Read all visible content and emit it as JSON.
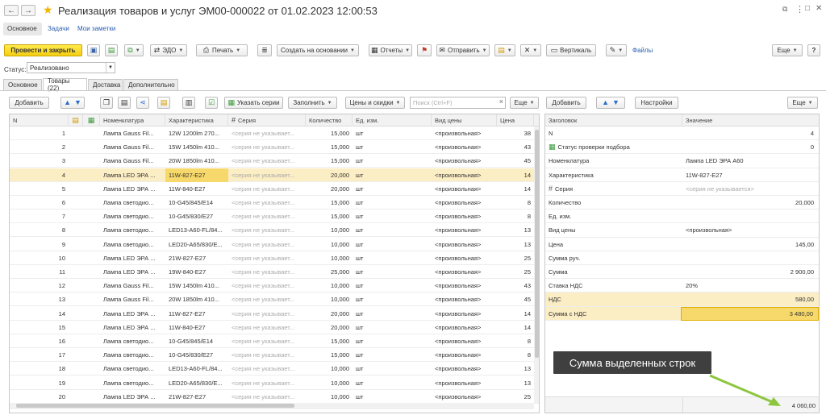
{
  "window": {
    "title": "Реализация товаров и услуг ЭМ00-000022 от 01.02.2023 12:00:53",
    "nav_back": "←",
    "nav_forward": "→",
    "star": "★",
    "link_icon": "🔗",
    "more_icon": "⋮",
    "maximize_icon": "□",
    "close_icon": "✕"
  },
  "top_links": [
    "Основное",
    "Задачи",
    "Мои заметки"
  ],
  "toolbar": {
    "post_close": "Провести и закрыть",
    "edo": "ЭДО",
    "print": "Печать",
    "create_based": "Создать на основании",
    "reports": "Отчеты",
    "send": "Отправить",
    "vertical": "Вертикаль",
    "files": "Файлы",
    "more": "Еще"
  },
  "status": {
    "label": "Статус:",
    "value": "Реализовано"
  },
  "tabs": [
    "Основное",
    "Товары (22)",
    "Доставка",
    "Дополнительно"
  ],
  "goods_toolbar": {
    "add": "Добавить",
    "specify_series": "Указать серии",
    "fill": "Заполнить",
    "prices_discounts": "Цены и скидки",
    "search_placeholder": "Поиск (Ctrl+F)",
    "search_clear": "×",
    "more": "Еще"
  },
  "props_toolbar": {
    "add": "Добавить",
    "settings": "Настройки",
    "more": "Еще"
  },
  "goods_table": {
    "headers": [
      "N",
      "Номенклатура",
      "Характеристика",
      "Серия",
      "Количество",
      "Ед. изм.",
      "Вид цены",
      "Цена"
    ],
    "rows": [
      {
        "n": "1",
        "name": "Лампа Gauss Fil...",
        "char": "12W 1200lm 270...",
        "series": "<серия не указывает...",
        "qty": "15,000",
        "unit": "шт",
        "price_type": "<произвольная>",
        "price": "38"
      },
      {
        "n": "2",
        "name": "Лампа Gauss Fil...",
        "char": "15W 1450lm 410...",
        "series": "<серия не указывает...",
        "qty": "15,000",
        "unit": "шт",
        "price_type": "<произвольная>",
        "price": "43"
      },
      {
        "n": "3",
        "name": "Лампа Gauss Fil...",
        "char": "20W 1850lm 410...",
        "series": "<серия не указывает...",
        "qty": "15,000",
        "unit": "шт",
        "price_type": "<произвольная>",
        "price": "45"
      },
      {
        "n": "4",
        "name": "Лампа LED ЭРА ...",
        "char": "11W-827-E27",
        "series": "<серия не указывает...",
        "qty": "20,000",
        "unit": "шт",
        "price_type": "<произвольная>",
        "price": "14"
      },
      {
        "n": "5",
        "name": "Лампа LED ЭРА ...",
        "char": "11W-840-E27",
        "series": "<серия не указывает...",
        "qty": "20,000",
        "unit": "шт",
        "price_type": "<произвольная>",
        "price": "14"
      },
      {
        "n": "6",
        "name": "Лампа светодио...",
        "char": "10-G45/845/E14",
        "series": "<серия не указывает...",
        "qty": "15,000",
        "unit": "шт",
        "price_type": "<произвольная>",
        "price": "8"
      },
      {
        "n": "7",
        "name": "Лампа светодио...",
        "char": "10-G45/830/E27",
        "series": "<серия не указывает...",
        "qty": "15,000",
        "unit": "шт",
        "price_type": "<произвольная>",
        "price": "8"
      },
      {
        "n": "8",
        "name": "Лампа светодио...",
        "char": "LED13-A60-FL/84...",
        "series": "<серия не указывает...",
        "qty": "10,000",
        "unit": "шт",
        "price_type": "<произвольная>",
        "price": "13"
      },
      {
        "n": "9",
        "name": "Лампа светодио...",
        "char": "LED20-A65/830/E...",
        "series": "<серия не указывает...",
        "qty": "10,000",
        "unit": "шт",
        "price_type": "<произвольная>",
        "price": "13"
      },
      {
        "n": "10",
        "name": "Лампа LED ЭРА ...",
        "char": "21W-827-E27",
        "series": "<серия не указывает...",
        "qty": "10,000",
        "unit": "шт",
        "price_type": "<произвольная>",
        "price": "25"
      },
      {
        "n": "11",
        "name": "Лампа LED ЭРА ...",
        "char": "19W-840-E27",
        "series": "<серия не указывает...",
        "qty": "25,000",
        "unit": "шт",
        "price_type": "<произвольная>",
        "price": "25"
      },
      {
        "n": "12",
        "name": "Лампа Gauss Fil...",
        "char": "15W 1450lm 410...",
        "series": "<серия не указывает...",
        "qty": "10,000",
        "unit": "шт",
        "price_type": "<произвольная>",
        "price": "43"
      },
      {
        "n": "13",
        "name": "Лампа Gauss Fil...",
        "char": "20W 1850lm 410...",
        "series": "<серия не указывает...",
        "qty": "10,000",
        "unit": "шт",
        "price_type": "<произвольная>",
        "price": "45"
      },
      {
        "n": "14",
        "name": "Лампа LED ЭРА ...",
        "char": "11W-827-E27",
        "series": "<серия не указывает...",
        "qty": "20,000",
        "unit": "шт",
        "price_type": "<произвольная>",
        "price": "14"
      },
      {
        "n": "15",
        "name": "Лампа LED ЭРА ...",
        "char": "11W-840-E27",
        "series": "<серия не указывает...",
        "qty": "20,000",
        "unit": "шт",
        "price_type": "<произвольная>",
        "price": "14"
      },
      {
        "n": "16",
        "name": "Лампа светодио...",
        "char": "10-G45/845/E14",
        "series": "<серия не указывает...",
        "qty": "15,000",
        "unit": "шт",
        "price_type": "<произвольная>",
        "price": "8"
      },
      {
        "n": "17",
        "name": "Лампа светодио...",
        "char": "10-G45/830/E27",
        "series": "<серия не указывает...",
        "qty": "15,000",
        "unit": "шт",
        "price_type": "<произвольная>",
        "price": "8"
      },
      {
        "n": "18",
        "name": "Лампа светодио...",
        "char": "LED13-A60-FL/84...",
        "series": "<серия не указывает...",
        "qty": "10,000",
        "unit": "шт",
        "price_type": "<произвольная>",
        "price": "13"
      },
      {
        "n": "19",
        "name": "Лампа светодио...",
        "char": "LED20-A65/830/E...",
        "series": "<серия не указывает...",
        "qty": "10,000",
        "unit": "шт",
        "price_type": "<произвольная>",
        "price": "13"
      },
      {
        "n": "20",
        "name": "Лампа LED ЭРА ...",
        "char": "21W-827-E27",
        "series": "<серия не указывает...",
        "qty": "10,000",
        "unit": "шт",
        "price_type": "<произвольная>",
        "price": "25"
      }
    ]
  },
  "props_table": {
    "headers": [
      "Заголовок",
      "Значение"
    ],
    "rows": [
      {
        "label": "N",
        "value": "4"
      },
      {
        "label": "Статус проверки подбора",
        "value": "0"
      },
      {
        "label": "Номенклатура",
        "value": "Лампа LED ЭРА A60"
      },
      {
        "label": "Характеристика",
        "value": "11W-827-E27"
      },
      {
        "label": "Серия",
        "value": "<серия не указывается>"
      },
      {
        "label": "Количество",
        "value": "20,000"
      },
      {
        "label": "Ед. изм.",
        "value": ""
      },
      {
        "label": "Вид цены",
        "value": "<произвольная>"
      },
      {
        "label": "Цена",
        "value": "145,00"
      },
      {
        "label": "Сумма руч.",
        "value": ""
      },
      {
        "label": "Сумма",
        "value": "2 900,00"
      },
      {
        "label": "Ставка НДС",
        "value": "20%"
      },
      {
        "label": "НДС",
        "value": "580,00"
      },
      {
        "label": "Сумма с НДС",
        "value": "3 480,00"
      }
    ],
    "total": "4 060,00"
  },
  "callout": {
    "text": "Сумма выделенных строк",
    "arrow_color": "#8cc63f"
  },
  "colors": {
    "accent_yellow": "#f4cf12",
    "selection": "#fbedc4",
    "link": "#2a5db0"
  }
}
